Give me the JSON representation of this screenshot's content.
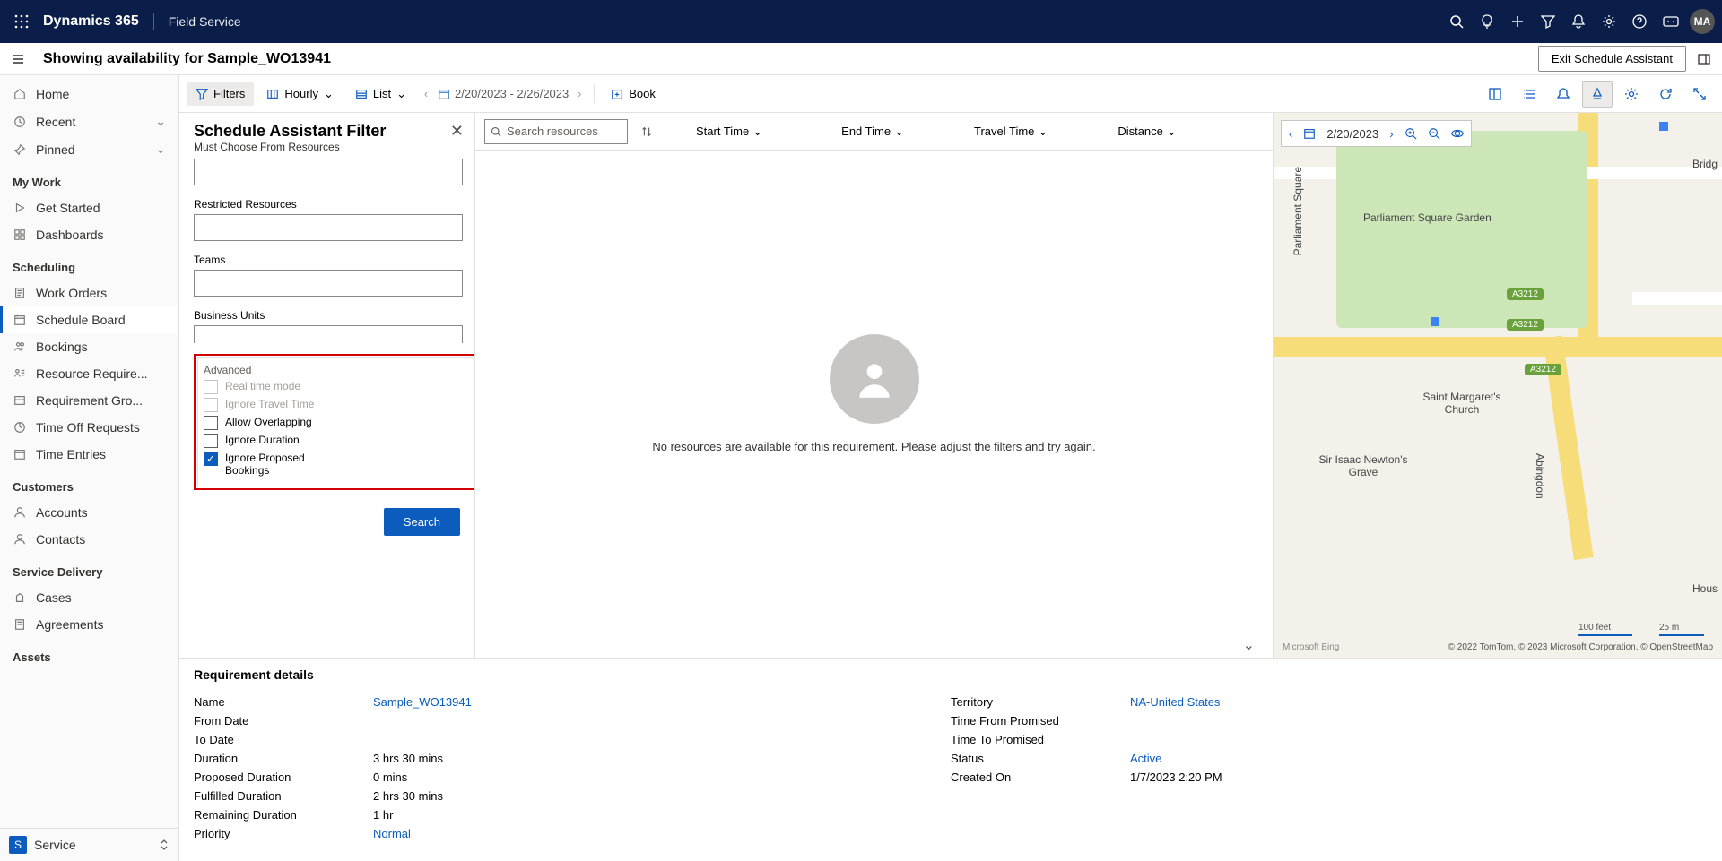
{
  "topnav": {
    "brand": "Dynamics 365",
    "app": "Field Service",
    "avatar": "MA"
  },
  "cmdbar": {
    "title": "Showing availability for Sample_WO13941",
    "exit": "Exit Schedule Assistant"
  },
  "sidebar": {
    "home": "Home",
    "recent": "Recent",
    "pinned": "Pinned",
    "section1": "My Work",
    "getstarted": "Get Started",
    "dashboards": "Dashboards",
    "section2": "Scheduling",
    "workorders": "Work Orders",
    "scheduleboard": "Schedule Board",
    "bookings": "Bookings",
    "resourcereq": "Resource Require...",
    "reqgroups": "Requirement Gro...",
    "timeoff": "Time Off Requests",
    "timeentries": "Time Entries",
    "section3": "Customers",
    "accounts": "Accounts",
    "contacts": "Contacts",
    "section4": "Service Delivery",
    "cases": "Cases",
    "agreements": "Agreements",
    "section5": "Assets",
    "footer_letter": "S",
    "footer": "Service"
  },
  "toolbar": {
    "filters": "Filters",
    "hourly": "Hourly",
    "list": "List",
    "daterange": "2/20/2023 - 2/26/2023",
    "book": "Book"
  },
  "filter": {
    "title": "Schedule Assistant Filter",
    "subtitle": "Must Choose From Resources",
    "restricted": "Restricted Resources",
    "teams": "Teams",
    "bu": "Business Units",
    "advanced": "Advanced",
    "realtime": "Real time mode",
    "ignoretravel": "Ignore Travel Time",
    "overlap": "Allow Overlapping",
    "ignoredur": "Ignore Duration",
    "ignoreprop": "Ignore Proposed Bookings",
    "search": "Search"
  },
  "results": {
    "search_ph": "Search resources",
    "start": "Start Time",
    "end": "End Time",
    "travel": "Travel Time",
    "dist": "Distance",
    "empty": "No resources are available for this requirement. Please adjust the filters and try again."
  },
  "map": {
    "date": "2/20/2023",
    "park": "Parliament Square Garden",
    "church": "Saint Margaret's Church",
    "grave": "Sir Isaac Newton's Grave",
    "ps": "Parliament Square",
    "bridg": "Bridg",
    "hous": "Hous",
    "abing": "Abingdon",
    "a3212": "A3212",
    "scale_ft": "100 feet",
    "scale_m": "25 m",
    "bing": "Microsoft Bing",
    "attr": "© 2022 TomTom, © 2023 Microsoft Corporation, © OpenStreetMap"
  },
  "details": {
    "title": "Requirement details",
    "name_k": "Name",
    "name_v": "Sample_WO13941",
    "from_k": "From Date",
    "to_k": "To Date",
    "dur_k": "Duration",
    "dur_v": "3 hrs 30 mins",
    "pdur_k": "Proposed Duration",
    "pdur_v": "0 mins",
    "fdur_k": "Fulfilled Duration",
    "fdur_v": "2 hrs 30 mins",
    "rdur_k": "Remaining Duration",
    "rdur_v": "1 hr",
    "prio_k": "Priority",
    "prio_v": "Normal",
    "terr_k": "Territory",
    "terr_v": "NA-United States",
    "tfp_k": "Time From Promised",
    "ttp_k": "Time To Promised",
    "status_k": "Status",
    "status_v": "Active",
    "created_k": "Created On",
    "created_v": "1/7/2023 2:20 PM"
  }
}
